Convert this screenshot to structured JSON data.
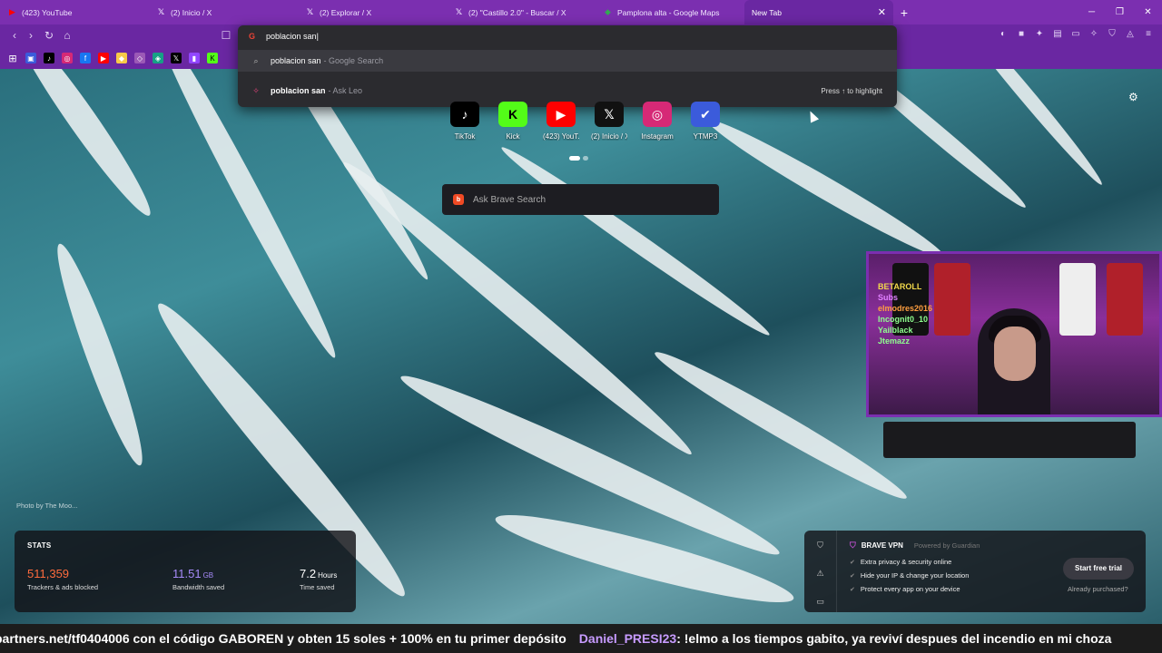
{
  "tabs": [
    {
      "title": "(423) YouTube",
      "icon": "youtube-icon",
      "color": "#ff0000",
      "glyph": "▶"
    },
    {
      "title": "(2) Inicio / X",
      "icon": "x-icon",
      "color": "#000000",
      "glyph": "𝕏"
    },
    {
      "title": "(2) Explorar / X",
      "icon": "x-icon",
      "color": "#000000",
      "glyph": "𝕏"
    },
    {
      "title": "(2) \"Castillo 2.0\" - Buscar / X",
      "icon": "x-icon",
      "color": "#000000",
      "glyph": "𝕏"
    },
    {
      "title": "Pamplona alta - Google Maps",
      "icon": "google-maps-icon",
      "color": "#34a853",
      "glyph": "⬥"
    },
    {
      "title": "New Tab",
      "icon": "none",
      "color": "",
      "glyph": ""
    }
  ],
  "omnibox": {
    "input": "poblacion san",
    "suggestions": [
      {
        "bold": "poblacion san",
        "suffix": " - Google Search",
        "icon": "search-icon"
      },
      {
        "bold": "poblacion san",
        "suffix": " - Ask Leo",
        "icon": "leo-icon"
      }
    ],
    "hint": "Press ↑ to highlight"
  },
  "top_sites": [
    {
      "label": "TikTok",
      "glyph": "♪",
      "bg": "#000000",
      "fg": "#ffffff"
    },
    {
      "label": "Kick",
      "glyph": "K",
      "bg": "#53fc18",
      "fg": "#000000"
    },
    {
      "label": "(423) YouT...",
      "glyph": "▶",
      "bg": "#ff0000",
      "fg": "#ffffff"
    },
    {
      "label": "(2) Inicio / X",
      "glyph": "𝕏",
      "bg": "#111111",
      "fg": "#ffffff"
    },
    {
      "label": "Instagram",
      "glyph": "◎",
      "bg": "#d62976",
      "fg": "#ffffff"
    },
    {
      "label": "YTMP3",
      "glyph": "✔",
      "bg": "#3b5bdb",
      "fg": "#ffffff"
    }
  ],
  "search": {
    "placeholder": "Ask Brave Search"
  },
  "photo_credit": "Photo by The Moo...",
  "stats": {
    "title": "STATS",
    "trackers": {
      "value": "511,359",
      "label": "Trackers & ads blocked",
      "color": "#ff6b3d"
    },
    "bandwidth": {
      "value": "11.51",
      "unit": "GB",
      "label": "Bandwidth saved",
      "color": "#a78bfa"
    },
    "time": {
      "value": "7.2",
      "unit": "Hours",
      "label": "Time saved",
      "color": "#ffffff"
    }
  },
  "vpn": {
    "title": "BRAVE VPN",
    "powered": "Powered by Guardian",
    "features": [
      "Extra privacy & security online",
      "Hide your IP & change your location",
      "Protect every app on your device"
    ],
    "cta": "Start free trial",
    "already": "Already purchased?"
  },
  "ticker": {
    "left": "partners.net/tf0404006 con el código GABOREN y obten 15 soles + 100% en tu primer depósito",
    "user": "Daniel_PRESI23",
    "message": ": !elmo a los tiempos gabito, ya reviví despues del incendio en mi choza"
  },
  "cam": {
    "sign_lines": [
      "BETAROLL",
      "Subs",
      "elmodres2016",
      "Incognit0_10",
      "Yailblack",
      "Jtemazz"
    ]
  }
}
